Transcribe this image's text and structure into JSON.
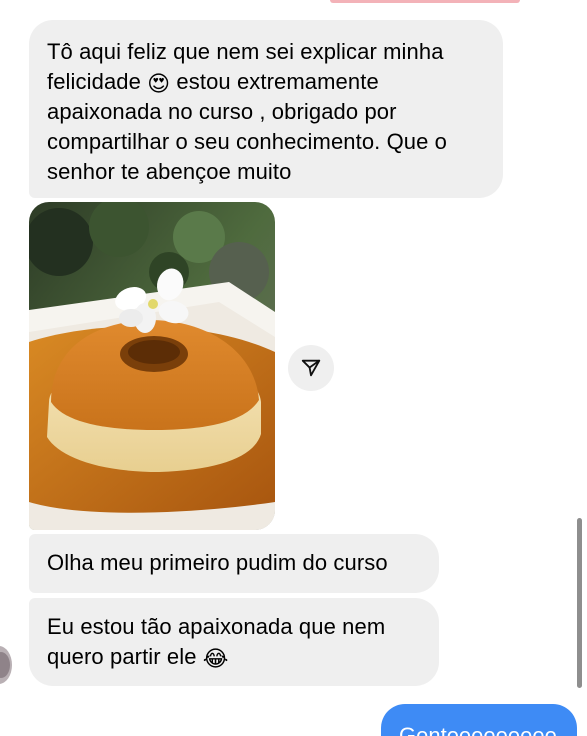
{
  "messages": [
    {
      "id": "msg1",
      "direction": "incoming",
      "text_part1": "Tô aqui feliz que nem sei explicar minha felicidade ",
      "emoji": "😍",
      "emoji_name": "heart-eyes-emoji",
      "text_part2": " estou extremamente apaixonada no curso , obrigado por compartilhar o seu conhecimento. Que o senhor te abençoe muito"
    },
    {
      "id": "photo1",
      "direction": "incoming",
      "type": "image",
      "subject": "pudim-photo"
    },
    {
      "id": "msg2",
      "direction": "incoming",
      "text": "Olha meu primeiro pudim do curso"
    },
    {
      "id": "msg3",
      "direction": "incoming",
      "text_part1": "Eu estou tão apaixonada que nem quero partir ele ",
      "emoji": "😂",
      "emoji_name": "tears-of-joy-emoji"
    },
    {
      "id": "msg4",
      "direction": "outgoing",
      "text": "Genteeeeeeeee"
    }
  ],
  "icons": {
    "share": "send-paper-plane-icon"
  },
  "colors": {
    "incoming_bubble": "#efefef",
    "outgoing_bubble": "#3e8bf5",
    "text": "#000000"
  }
}
